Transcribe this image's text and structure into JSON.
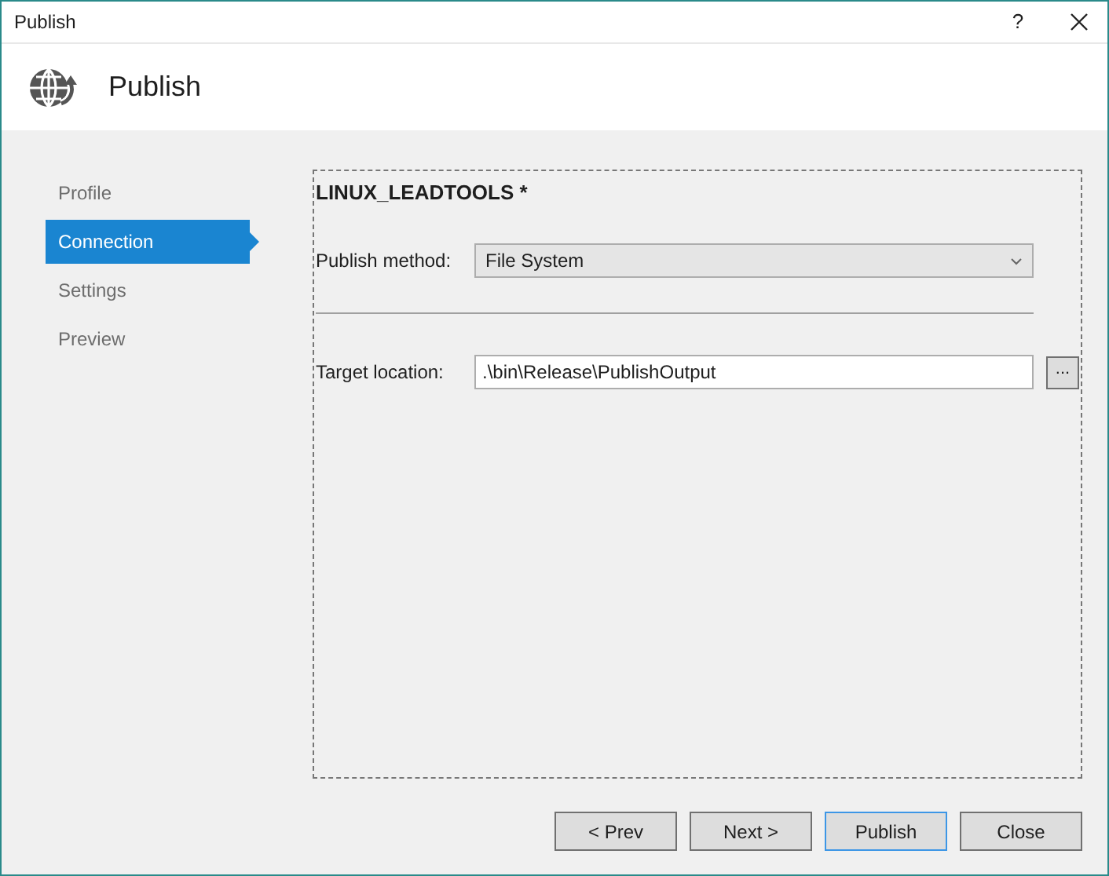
{
  "window": {
    "title": "Publish",
    "help": "?"
  },
  "header": {
    "title": "Publish"
  },
  "sidebar": {
    "items": [
      {
        "label": "Profile",
        "selected": false
      },
      {
        "label": "Connection",
        "selected": true
      },
      {
        "label": "Settings",
        "selected": false
      },
      {
        "label": "Preview",
        "selected": false
      }
    ]
  },
  "profile": {
    "title": "LINUX_LEADTOOLS *"
  },
  "publish_method": {
    "label": "Publish method:",
    "value": "File System"
  },
  "target_location": {
    "label": "Target location:",
    "value": ".\\bin\\Release\\PublishOutput",
    "browse": "..."
  },
  "buttons": [
    {
      "label": "< Prev",
      "focused": false
    },
    {
      "label": "Next >",
      "focused": false
    },
    {
      "label": "Publish",
      "focused": true
    },
    {
      "label": "Close",
      "focused": false
    }
  ]
}
